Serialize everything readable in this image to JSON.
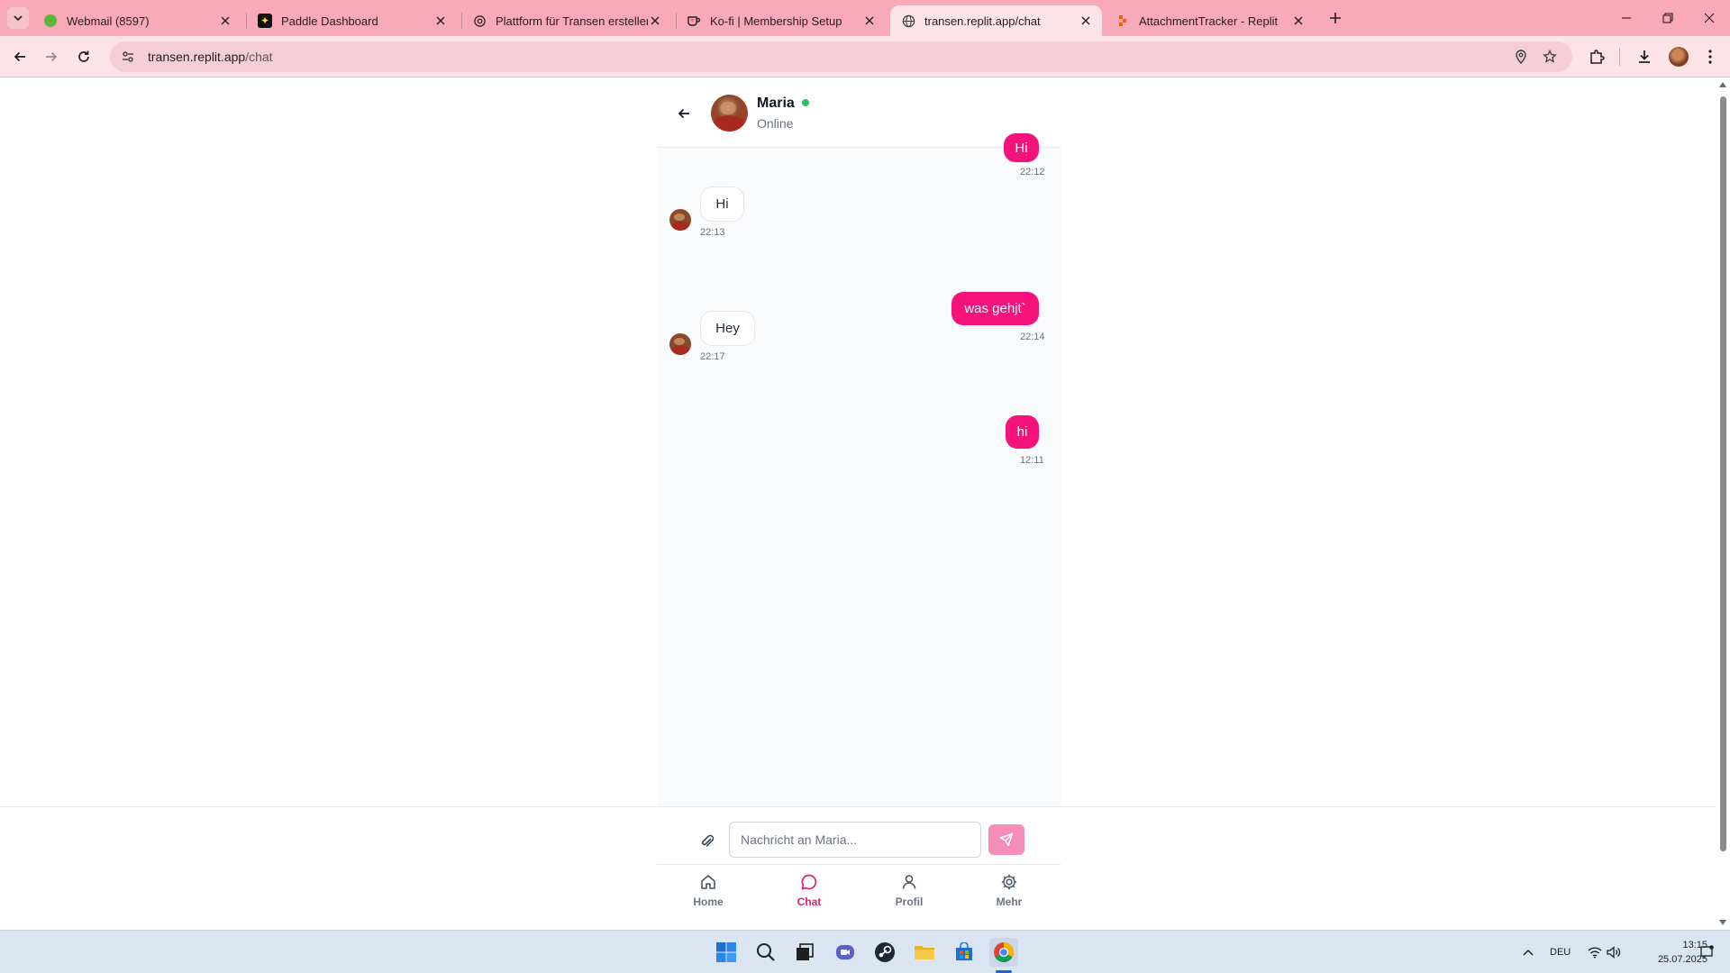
{
  "browser": {
    "tabs": [
      {
        "title": "Webmail (8597)",
        "favicon": "green-dot-icon",
        "active": false
      },
      {
        "title": "Paddle Dashboard",
        "favicon": "paddle-icon",
        "active": false
      },
      {
        "title": "Plattform für Transen erstellen",
        "favicon": "openai-icon",
        "active": false
      },
      {
        "title": "Ko-fi | Membership Setup",
        "favicon": "kofi-icon",
        "active": false
      },
      {
        "title": "transen.replit.app/chat",
        "favicon": "globe-icon",
        "active": true
      },
      {
        "title": "AttachmentTracker - Replit",
        "favicon": "replit-icon",
        "active": false
      }
    ],
    "url_host": "transen.replit.app",
    "url_path": "/chat",
    "theme_color": "#f8a9ba"
  },
  "chat": {
    "contact_name": "Maria",
    "status": "Online",
    "accent": "#f5127a",
    "messages": [
      {
        "from": "me",
        "text": "Hi",
        "time": "22:12"
      },
      {
        "from": "contact",
        "text": "Hi",
        "time": "22:13"
      },
      {
        "from": "me",
        "text": "was gehjt`",
        "time": "22:14"
      },
      {
        "from": "contact",
        "text": "Hey",
        "time": "22:17"
      },
      {
        "from": "me",
        "text": "hi",
        "time": "12:11"
      }
    ],
    "composer": {
      "placeholder": "Nachricht an Maria...",
      "value": ""
    }
  },
  "bottom_nav": [
    {
      "label": "Home",
      "icon": "home-icon",
      "active": false
    },
    {
      "label": "Chat",
      "icon": "chat-bubble-icon",
      "active": true
    },
    {
      "label": "Profil",
      "icon": "user-icon",
      "active": false
    },
    {
      "label": "Mehr",
      "icon": "gear-icon",
      "active": false
    }
  ],
  "taskbar": {
    "language": "DEU",
    "time": "13:15",
    "date": "25.07.2025"
  }
}
